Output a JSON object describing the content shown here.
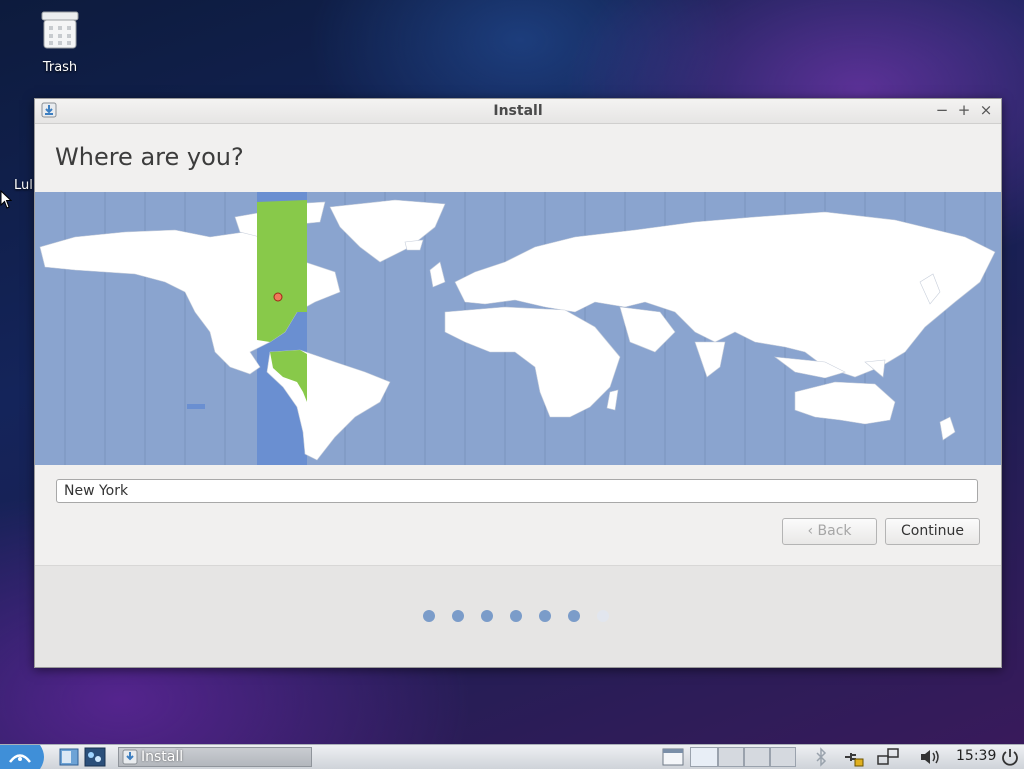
{
  "desktop": {
    "trash_label": "Trash",
    "partial_label": "Lul"
  },
  "window": {
    "title": "Install",
    "minimize": "−",
    "maximize": "+",
    "close": "×"
  },
  "page": {
    "heading": "Where are you?",
    "timezone_value": "New York",
    "back_label": "Back",
    "continue_label": "Continue",
    "progress": {
      "total": 7,
      "completed": 6
    }
  },
  "taskbar": {
    "task_label": "Install",
    "clock": "15:39"
  },
  "colors": {
    "ocean": "#8aa4cf",
    "land": "#ffffff",
    "selected_zone": "#6a8fd1",
    "selected_land": "#88c94a",
    "pin": "#f07a5a"
  }
}
